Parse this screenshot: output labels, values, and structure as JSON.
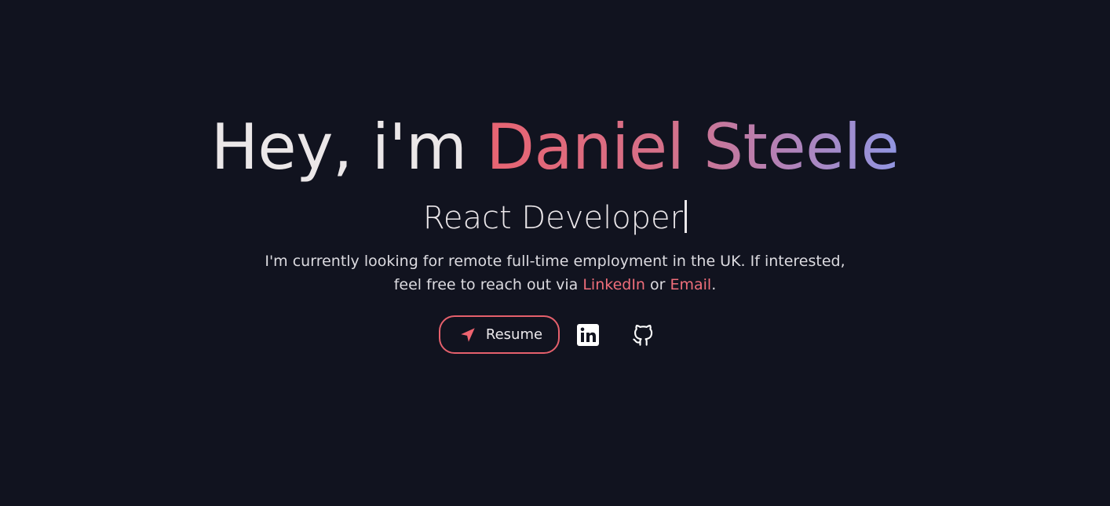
{
  "hero": {
    "greeting": "Hey, i'm ",
    "name": "Daniel Steele",
    "role": "React Developer",
    "intro": {
      "line1": "I'm currently looking for remote full-time employment in the UK. If interested,",
      "line2_prefix": "feel free to reach out via ",
      "linkedin_link": "LinkedIn",
      "connector": " or ",
      "email_link": "Email",
      "end": "."
    }
  },
  "actions": {
    "resume_label": "Resume",
    "icons": [
      "send-icon",
      "linkedin-icon",
      "github-icon"
    ]
  },
  "colors": {
    "background": "#11131f",
    "accent": "#e5606c",
    "gradient_start": "#e86472",
    "gradient_end": "#9196e2"
  }
}
